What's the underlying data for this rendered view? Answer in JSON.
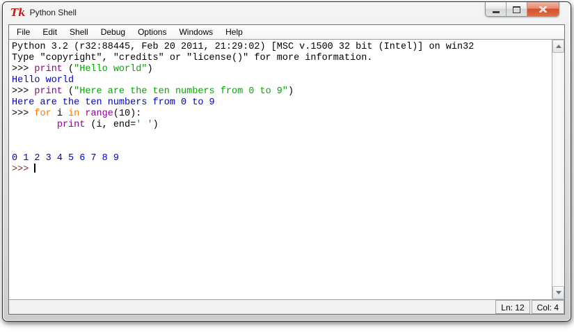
{
  "titlebar": {
    "title": "Python Shell",
    "tk_icon_text": "Tk"
  },
  "menu": {
    "items": [
      "File",
      "Edit",
      "Shell",
      "Debug",
      "Options",
      "Windows",
      "Help"
    ]
  },
  "colors": {
    "plain": "#000000",
    "stdout_blue": "#0000cd",
    "string_green": "#00aa00",
    "builtin_purple": "#900090",
    "keyword_orange": "#ff7700",
    "last_prompt_red": "#7a2e2e"
  },
  "shell_lines": [
    [
      {
        "t": "Python 3.2 (r32:88445, Feb 20 2011, 21:29:02) [MSC v.1500 32 bit (Intel)] on win32",
        "c": "plain"
      }
    ],
    [
      {
        "t": "Type \"copyright\", \"credits\" or \"license()\" for more information.",
        "c": "plain"
      }
    ],
    [
      {
        "t": ">>> ",
        "c": "plain"
      },
      {
        "t": "print",
        "c": "builtin_purple"
      },
      {
        "t": " (",
        "c": "plain"
      },
      {
        "t": "\"Hello world\"",
        "c": "string_green"
      },
      {
        "t": ")",
        "c": "plain"
      }
    ],
    [
      {
        "t": "Hello world",
        "c": "stdout_blue"
      }
    ],
    [
      {
        "t": ">>> ",
        "c": "plain"
      },
      {
        "t": "print",
        "c": "builtin_purple"
      },
      {
        "t": " (",
        "c": "plain"
      },
      {
        "t": "\"Here are the ten numbers from 0 to 9\"",
        "c": "string_green"
      },
      {
        "t": ")",
        "c": "plain"
      }
    ],
    [
      {
        "t": "Here are the ten numbers from 0 to 9",
        "c": "stdout_blue"
      }
    ],
    [
      {
        "t": ">>> ",
        "c": "plain"
      },
      {
        "t": "for",
        "c": "keyword_orange"
      },
      {
        "t": " i ",
        "c": "plain"
      },
      {
        "t": "in",
        "c": "keyword_orange"
      },
      {
        "t": " ",
        "c": "plain"
      },
      {
        "t": "range",
        "c": "builtin_purple"
      },
      {
        "t": "(10):",
        "c": "plain"
      }
    ],
    [
      {
        "t": "        ",
        "c": "plain"
      },
      {
        "t": "print",
        "c": "builtin_purple"
      },
      {
        "t": " (i, end=",
        "c": "plain"
      },
      {
        "t": "' '",
        "c": "string_green"
      },
      {
        "t": ")",
        "c": "plain"
      }
    ],
    [],
    [],
    [
      {
        "t": "0 1 2 3 4 5 6 7 8 9",
        "c": "stdout_blue"
      }
    ],
    [
      {
        "t": ">>> ",
        "c": "last_prompt_red"
      }
    ]
  ],
  "cursor": {
    "line": 12,
    "col": 4
  },
  "status_bar": {
    "line": "Ln: 12",
    "column": "Col: 4"
  }
}
